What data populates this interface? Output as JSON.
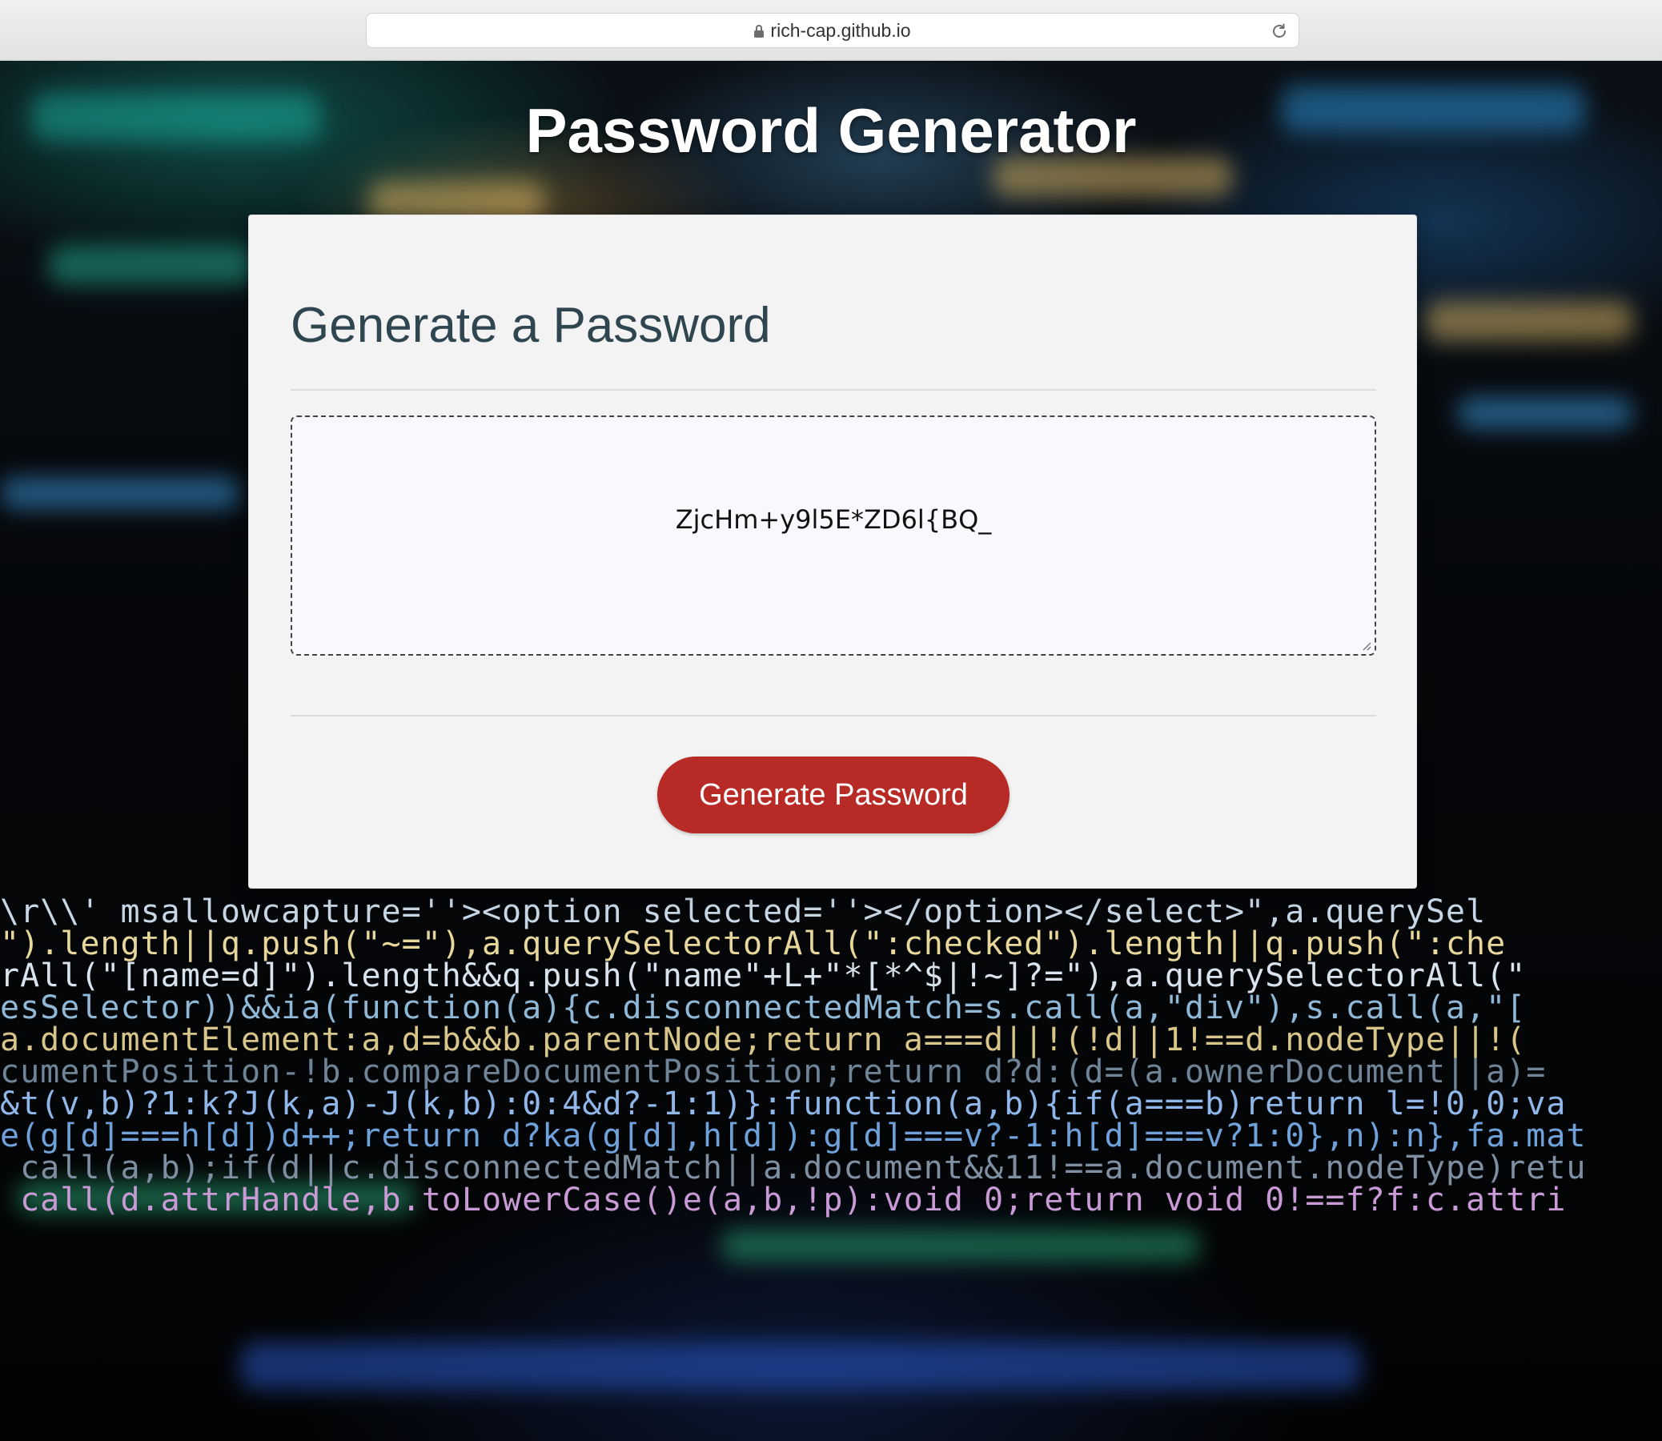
{
  "browser": {
    "url": "rich-cap.github.io"
  },
  "page": {
    "title": "Password Generator"
  },
  "card": {
    "title": "Generate a Password",
    "password": "ZjcHm+y9l5E*ZD6l{BQ_",
    "button_label": "Generate Password"
  },
  "colors": {
    "button": "#b72a25",
    "card_title": "#2f4550",
    "card_background": "#f3f3f3"
  },
  "background": {
    "code_lines": [
      "\\r\\\\' msallowcapture=''><option selected=''></option></select>\",a.querySel",
      "\").length||q.push(\"~=\"),a.querySelectorAll(\":checked\").length||q.push(\":che",
      "rAll(\"[name=d]\").length&&q.push(\"name\"+L+\"*[*^$|!~]?=\"),a.querySelectorAll(\"",
      "esSelector))&&ia(function(a){c.disconnectedMatch=s.call(a,\"div\"),s.call(a,\"[",
      "a.documentElement:a,d=b&&b.parentNode;return a===d||!(!d||1!==d.nodeType||!(",
      "cumentPosition-!b.compareDocumentPosition;return d?d:(d=(a.ownerDocument||a)=",
      "&t(v,b)?1:k?J(k,a)-J(k,b):0:4&d?-1:1)}:function(a,b){if(a===b)return l=!0,0;va",
      "e(g[d]===h[d])d++;return d?ka(g[d],h[d]):g[d]===v?-1:h[d]===v?1:0},n):n},fa.mat",
      " call(a,b);if(d||c.disconnectedMatch||a.document&&11!==a.document.nodeType)retu",
      " call(d.attrHandle,b.toLowerCase()e(a,b,!p):void 0;return void 0!==f?f:c.attri"
    ]
  }
}
